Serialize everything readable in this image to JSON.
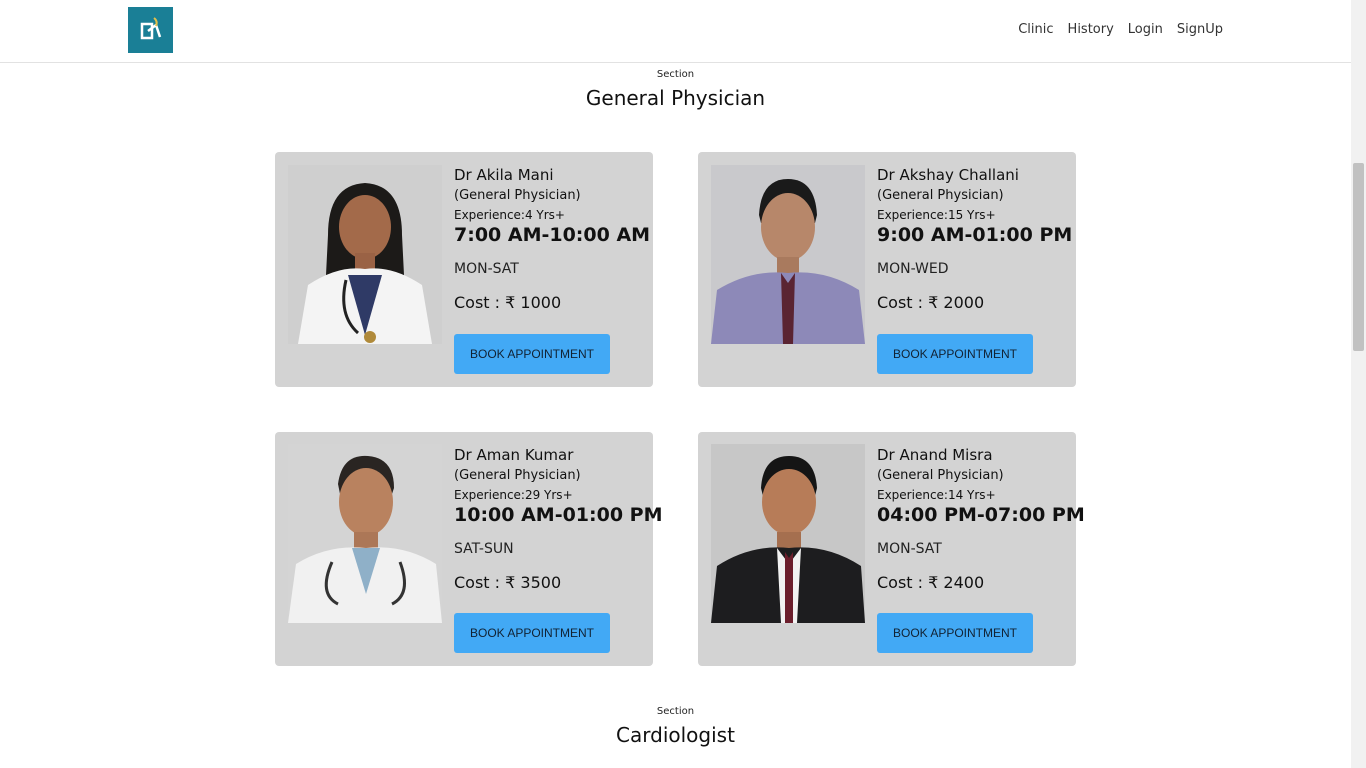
{
  "nav": {
    "links": [
      "Clinic",
      "History",
      "Login",
      "SignUp"
    ]
  },
  "sections": [
    {
      "label": "Section",
      "title": "General Physician",
      "doctors": [
        {
          "name": "Dr Akila Mani",
          "specialty": "(General Physician)",
          "experience": "Experience:4 Yrs+",
          "time": "7:00 AM-10:00 AM",
          "days": "MON-SAT",
          "cost": "Cost : ₹ 1000",
          "button": "BOOK APPOINTMENT"
        },
        {
          "name": "Dr Akshay Challani",
          "specialty": "(General Physician)",
          "experience": "Experience:15 Yrs+",
          "time": "9:00 AM-01:00 PM",
          "days": "MON-WED",
          "cost": "Cost : ₹ 2000",
          "button": "BOOK APPOINTMENT"
        },
        {
          "name": "Dr Aman Kumar",
          "specialty": "(General Physician)",
          "experience": "Experience:29 Yrs+",
          "time": "10:00 AM-01:00 PM",
          "days": "SAT-SUN",
          "cost": "Cost : ₹ 3500",
          "button": "BOOK APPOINTMENT"
        },
        {
          "name": "Dr Anand Misra",
          "specialty": "(General Physician)",
          "experience": "Experience:14 Yrs+",
          "time": "04:00 PM-07:00 PM",
          "days": "MON-SAT",
          "cost": "Cost : ₹ 2400",
          "button": "BOOK APPOINTMENT"
        }
      ]
    },
    {
      "label": "Section",
      "title": "Cardiologist"
    }
  ],
  "colors": {
    "brand": "#1a7f96",
    "card_bg": "#d3d3d3",
    "button": "#42a9f5"
  }
}
